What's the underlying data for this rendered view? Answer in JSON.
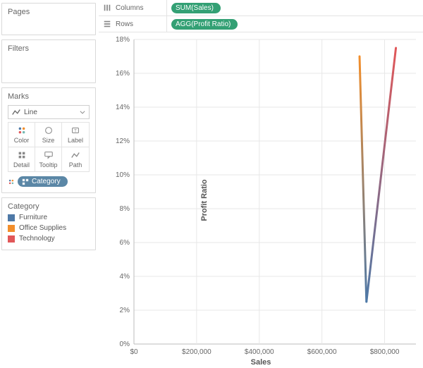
{
  "sidebar": {
    "pages_title": "Pages",
    "filters_title": "Filters",
    "marks_title": "Marks",
    "mark_type": "Line",
    "mark_cells": [
      "Color",
      "Size",
      "Label",
      "Detail",
      "Tooltip",
      "Path"
    ],
    "category_pill": "Category",
    "legend_title": "Category",
    "legend": [
      {
        "label": "Furniture",
        "color": "#4e79a7"
      },
      {
        "label": "Office Supplies",
        "color": "#f28e2b"
      },
      {
        "label": "Technology",
        "color": "#e15759"
      }
    ]
  },
  "shelves": {
    "columns_label": "Columns",
    "rows_label": "Rows",
    "columns_field": "SUM(Sales)",
    "rows_field": "AGG(Profit Ratio)"
  },
  "chart_data": {
    "type": "line",
    "xlabel": "Sales",
    "ylabel": "Profit Ratio",
    "xlim": [
      0,
      900000
    ],
    "ylim": [
      0,
      0.18
    ],
    "x_ticks": [
      0,
      200000,
      400000,
      600000,
      800000
    ],
    "x_tick_labels": [
      "$0",
      "$200,000",
      "$400,000",
      "$600,000",
      "$800,000"
    ],
    "y_ticks": [
      0,
      0.02,
      0.04,
      0.06,
      0.08,
      0.1,
      0.12,
      0.14,
      0.16,
      0.18
    ],
    "y_tick_labels": [
      "0%",
      "2%",
      "4%",
      "6%",
      "8%",
      "10%",
      "12%",
      "14%",
      "16%",
      "18%"
    ],
    "series": [
      {
        "name": "Office Supplies",
        "color": "#f28e2b",
        "sales": 720000,
        "profit_ratio": 0.17
      },
      {
        "name": "Furniture",
        "color": "#4e79a7",
        "sales": 742000,
        "profit_ratio": 0.025
      },
      {
        "name": "Technology",
        "color": "#e15759",
        "sales": 836000,
        "profit_ratio": 0.175
      }
    ]
  }
}
